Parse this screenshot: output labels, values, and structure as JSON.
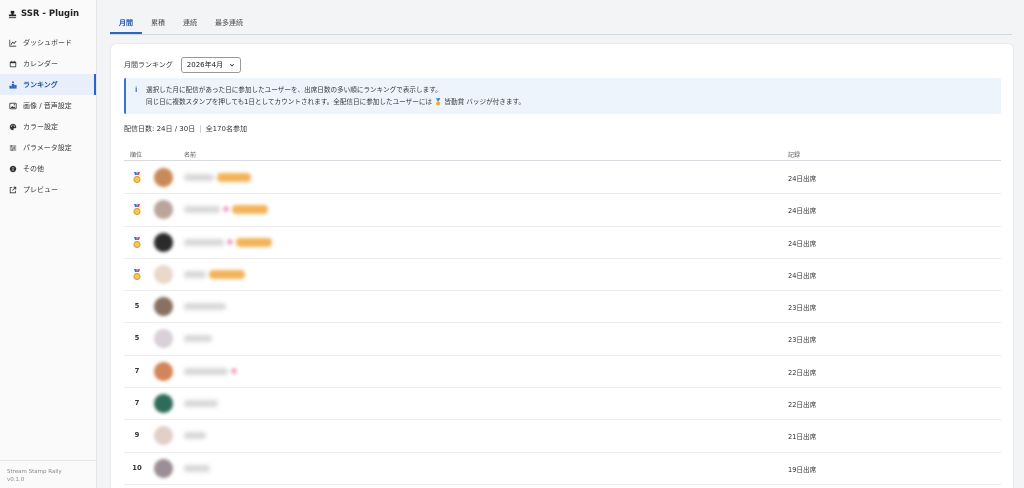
{
  "app": {
    "title": "SSR - Plugin"
  },
  "sidebar": {
    "items": [
      {
        "label": "ダッシュボード",
        "icon": "chart-icon",
        "active": false
      },
      {
        "label": "カレンダー",
        "icon": "calendar-icon",
        "active": false
      },
      {
        "label": "ランキング",
        "icon": "ranking-icon",
        "active": true
      },
      {
        "label": "画像 / 音声設定",
        "icon": "image-icon",
        "active": false
      },
      {
        "label": "カラー設定",
        "icon": "palette-icon",
        "active": false
      },
      {
        "label": "パラメータ設定",
        "icon": "sliders-icon",
        "active": false
      },
      {
        "label": "その他",
        "icon": "info-icon",
        "active": false
      },
      {
        "label": "プレビュー",
        "icon": "external-icon",
        "active": false
      }
    ],
    "footer": {
      "name": "Stream Stamp Rally",
      "version": "v0.1.0"
    }
  },
  "tabs": [
    {
      "label": "月間",
      "active": true
    },
    {
      "label": "累積",
      "active": false
    },
    {
      "label": "連続",
      "active": false
    },
    {
      "label": "最多連続",
      "active": false
    }
  ],
  "filter": {
    "label": "月間ランキング",
    "selected": "2026年4月"
  },
  "info": {
    "line1": "選択した月に配信があった日に参加したユーザーを、出席日数の多い順にランキングで表示します。",
    "line2": "同じ日に複数スタンプを押しても1日としてカウントされます。全配信日に参加したユーザーには 🏅 皆勤賞 バッジが付きます。"
  },
  "summary": {
    "days": "配信日数: 24日 / 30日",
    "participants": "全170名参加"
  },
  "table": {
    "headers": {
      "rank": "順位",
      "name": "名前",
      "record": "記録"
    },
    "rows": [
      {
        "rank": "",
        "medal": true,
        "record": "24日出席"
      },
      {
        "rank": "",
        "medal": true,
        "record": "24日出席"
      },
      {
        "rank": "",
        "medal": true,
        "record": "24日出席"
      },
      {
        "rank": "",
        "medal": true,
        "record": "24日出席"
      },
      {
        "rank": "5",
        "medal": false,
        "record": "23日出席"
      },
      {
        "rank": "5",
        "medal": false,
        "record": "23日出席"
      },
      {
        "rank": "7",
        "medal": false,
        "record": "22日出席"
      },
      {
        "rank": "7",
        "medal": false,
        "record": "22日出席"
      },
      {
        "rank": "9",
        "medal": false,
        "record": "21日出席"
      },
      {
        "rank": "10",
        "medal": false,
        "record": "19日出席"
      }
    ]
  },
  "colors": {
    "accent": "#2a64c4",
    "badge": "#f3b35a"
  }
}
